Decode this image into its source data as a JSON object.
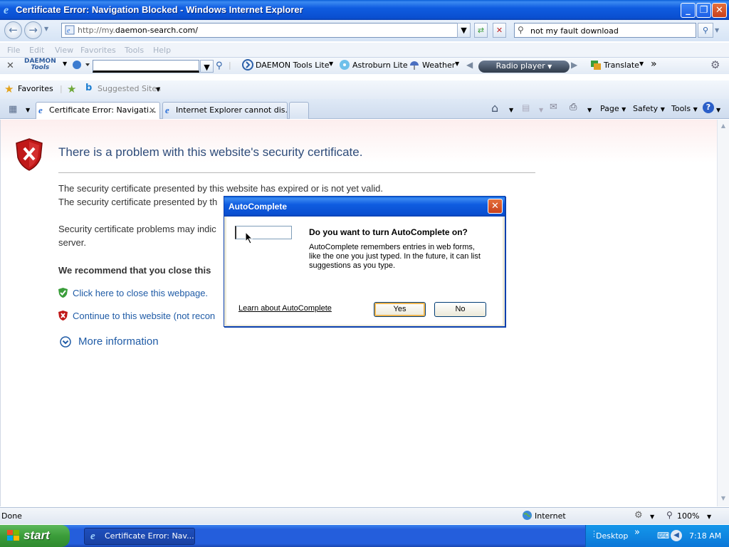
{
  "window": {
    "title": "Certificate Error: Navigation Blocked - Windows Internet Explorer",
    "minimize": "_",
    "restore": "❐",
    "close": "✕"
  },
  "address": {
    "url_prefix": "http://my.",
    "url_domain": "daemon-search.com/",
    "search_value": "not my fault download"
  },
  "menu": [
    "File",
    "Edit",
    "View",
    "Favorites",
    "Tools",
    "Help"
  ],
  "daemon_toolbar": {
    "logo_line1": "DAEMON",
    "logo_line2": "Tools",
    "daemon_lite": "DAEMON Tools Lite",
    "astroburn": "Astroburn Lite",
    "weather": "Weather",
    "radio": "Radio player",
    "translate": "Translate"
  },
  "favorites_bar": {
    "favorites": "Favorites",
    "suggested": "Suggested Sites"
  },
  "tabs": [
    {
      "label": "Certificate Error: Navigati..."
    },
    {
      "label": "Internet Explorer cannot dis..."
    }
  ],
  "command_bar": {
    "page": "Page",
    "safety": "Safety",
    "tools": "Tools"
  },
  "content": {
    "heading": "There is a problem with this website's security certificate.",
    "line1": "The security certificate presented by this website has expired or is not yet valid.",
    "line2": "The security certificate presented by th",
    "line3": "Security certificate problems may indic",
    "line3b": "server.",
    "recommend": "We recommend that you close this",
    "close_link": "Click here to close this webpage.",
    "continue_link": "Continue to this website (not recon",
    "more_info": "More information"
  },
  "dialog": {
    "title": "AutoComplete",
    "question": "Do you want to turn AutoComplete on?",
    "description": "AutoComplete remembers entries in web forms, like the one you just typed. In the future, it can list suggestions as you type.",
    "learn_link": "Learn about AutoComplete",
    "yes": "Yes",
    "no": "No"
  },
  "status": {
    "text": "Done",
    "zone": "Internet",
    "zoom": "100%"
  },
  "taskbar": {
    "start": "start",
    "task": "Certificate Error: Nav...",
    "desktop": "Desktop",
    "time": "7:18 AM"
  },
  "colors": {
    "title_blue": "#0a4fd0",
    "link_blue": "#1f5ba6",
    "heading_blue": "#2e4c7a",
    "error_red": "#c01818",
    "start_green": "#3b9d3a"
  }
}
